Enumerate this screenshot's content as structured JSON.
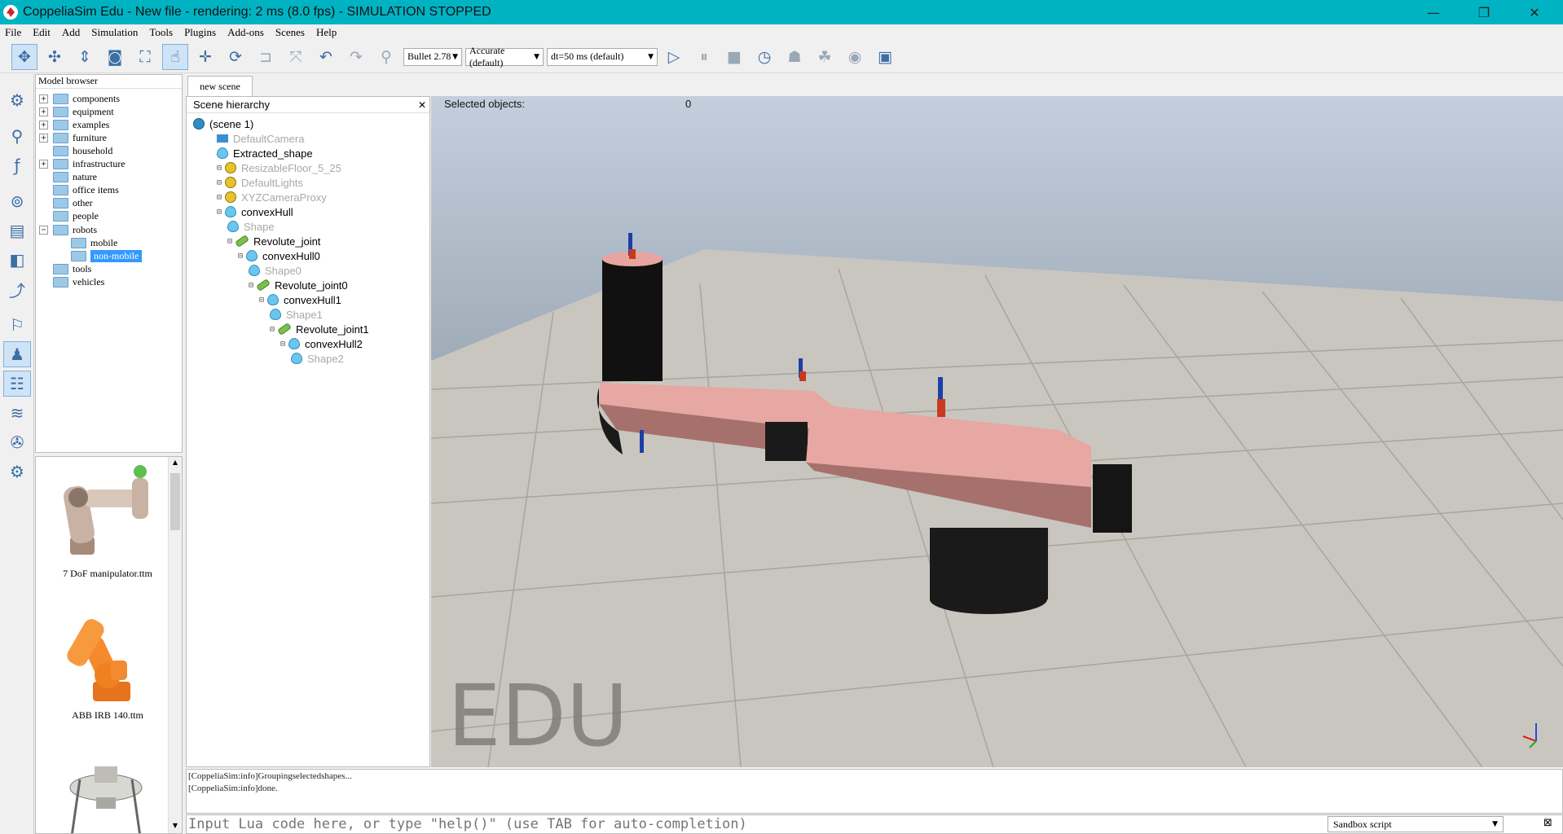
{
  "window": {
    "title": "CoppeliaSim Edu - New file - rendering: 2 ms (8.0 fps) - SIMULATION STOPPED",
    "minimize": "—",
    "maximize": "❐",
    "close": "✕"
  },
  "menu": [
    "File",
    "Edit",
    "Add",
    "Simulation",
    "Tools",
    "Plugins",
    "Add-ons",
    "Scenes",
    "Help"
  ],
  "toolbar": {
    "physics_engine": "Bullet 2.78",
    "accuracy": "Accurate (default)",
    "timestep": "dt=50 ms (default)"
  },
  "model_browser": {
    "title": "Model browser",
    "folders": [
      {
        "label": "components",
        "expand": "+"
      },
      {
        "label": "equipment",
        "expand": "+"
      },
      {
        "label": "examples",
        "expand": "+"
      },
      {
        "label": "furniture",
        "expand": "+"
      },
      {
        "label": "household",
        "expand": ""
      },
      {
        "label": "infrastructure",
        "expand": "+"
      },
      {
        "label": "nature",
        "expand": ""
      },
      {
        "label": "office items",
        "expand": ""
      },
      {
        "label": "other",
        "expand": ""
      },
      {
        "label": "people",
        "expand": ""
      },
      {
        "label": "robots",
        "expand": "−"
      },
      {
        "label": "mobile",
        "expand": ""
      },
      {
        "label": "non-mobile",
        "expand": ""
      },
      {
        "label": "tools",
        "expand": ""
      },
      {
        "label": "vehicles",
        "expand": ""
      }
    ],
    "thumbnails": [
      "7 DoF manipulator.ttm",
      "ABB IRB 140.ttm"
    ]
  },
  "tab": "new scene",
  "hierarchy": {
    "title": "Scene hierarchy",
    "close": "✕",
    "nodes": [
      {
        "label": "(scene 1)"
      },
      {
        "label": "DefaultCamera"
      },
      {
        "label": "Extracted_shape"
      },
      {
        "label": "ResizableFloor_5_25"
      },
      {
        "label": "DefaultLights"
      },
      {
        "label": "XYZCameraProxy"
      },
      {
        "label": "convexHull"
      },
      {
        "label": "Shape"
      },
      {
        "label": "Revolute_joint"
      },
      {
        "label": "convexHull0"
      },
      {
        "label": "Shape0"
      },
      {
        "label": "Revolute_joint0"
      },
      {
        "label": "convexHull1"
      },
      {
        "label": "Shape1"
      },
      {
        "label": "Revolute_joint1"
      },
      {
        "label": "convexHull2"
      },
      {
        "label": "Shape2"
      }
    ]
  },
  "scene": {
    "selected_label": "Selected objects:",
    "selected_count": "0",
    "watermark": "EDU"
  },
  "console": {
    "lines": [
      "[CoppeliaSim:info]Groupingselectedshapes...",
      "[CoppeliaSim:info]done."
    ]
  },
  "input": {
    "placeholder": "Input Lua code here, or type \"help()\" (use TAB for auto-completion)",
    "script": "Sandbox script"
  }
}
